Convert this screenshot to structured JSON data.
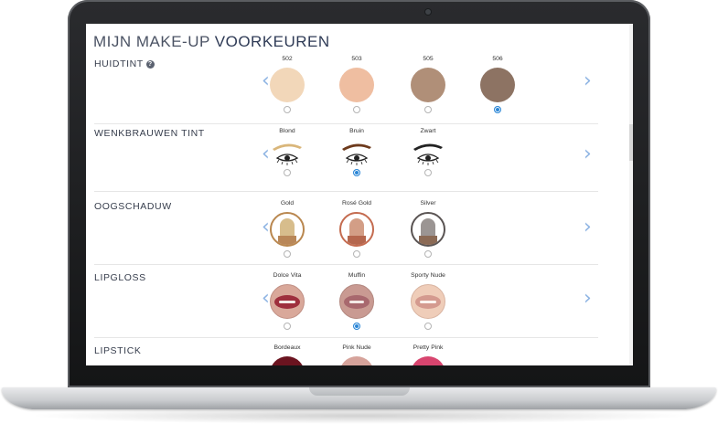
{
  "page": {
    "title_part1": "MIJN MAKE-UP ",
    "title_part2": "VOORKEUREN"
  },
  "sections": [
    {
      "label": "HUIDTINT",
      "help": "?",
      "options": [
        {
          "name": "502",
          "color": "#f2d7b9",
          "selected": false
        },
        {
          "name": "503",
          "color": "#efbea1",
          "selected": false
        },
        {
          "name": "505",
          "color": "#b08f78",
          "selected": false
        },
        {
          "name": "506",
          "color": "#8d7363",
          "selected": true
        }
      ]
    },
    {
      "label": "WENKBRAUWEN TINT",
      "options": [
        {
          "name": "Blond",
          "color": "#d9b67a",
          "selected": false
        },
        {
          "name": "Bruin",
          "color": "#6d3a1c",
          "selected": true
        },
        {
          "name": "Zwart",
          "color": "#222222",
          "selected": false
        }
      ]
    },
    {
      "label": "OOGSCHADUW",
      "options": [
        {
          "name": "Gold",
          "color": "#d7bd8c",
          "ring": "#b9874f",
          "selected": false
        },
        {
          "name": "Rosé Gold",
          "color": "#d39e86",
          "ring": "#c46b4f",
          "selected": false
        },
        {
          "name": "Silver",
          "color": "#9b9593",
          "ring": "#5a5453",
          "selected": false
        }
      ]
    },
    {
      "label": "LIPGLOSS",
      "options": [
        {
          "name": "Dolce Vita",
          "color": "#9e2f3d",
          "selected": false
        },
        {
          "name": "Muffin",
          "color": "#a8686e",
          "selected": true
        },
        {
          "name": "Sporty Nude",
          "color": "#d49a8f",
          "selected": false
        }
      ]
    },
    {
      "label": "LIPSTICK",
      "options": [
        {
          "name": "Bordeaux",
          "color": "#6b1420",
          "selected": false
        },
        {
          "name": "Pink Nude",
          "color": "#d6a39b",
          "selected": false
        },
        {
          "name": "Pretty Pink",
          "color": "#d8456f",
          "selected": false
        }
      ]
    }
  ],
  "icons": {
    "prev": "‹",
    "next": "›"
  },
  "colors": {
    "accent": "#2a86d6",
    "arrow": "#8eb4e3"
  }
}
